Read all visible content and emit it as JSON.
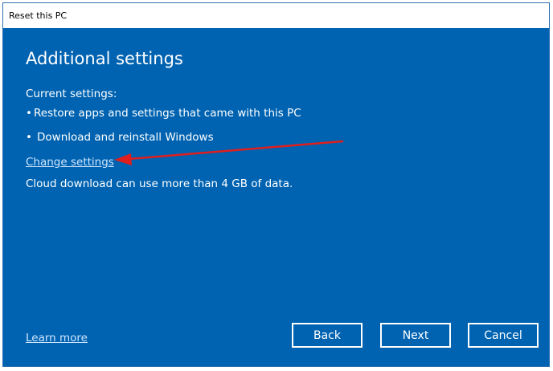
{
  "window": {
    "title": "Reset this PC"
  },
  "page": {
    "heading": "Additional settings",
    "current_settings_label": "Current settings:",
    "settings": [
      {
        "bullet": "•",
        "text": "Restore apps and settings that came with this PC"
      },
      {
        "bullet": "•",
        "text": "Download and reinstall Windows"
      }
    ],
    "change_settings_link": "Change settings",
    "cloud_note": "Cloud download can use more than 4 GB of data.",
    "learn_more_link": "Learn more"
  },
  "buttons": {
    "back": "Back",
    "next": "Next",
    "cancel": "Cancel"
  },
  "colors": {
    "accent_background": "#0063b1",
    "annotation_arrow": "#e01e1e"
  },
  "annotation": {
    "type": "arrow",
    "points_to": "Change settings"
  }
}
